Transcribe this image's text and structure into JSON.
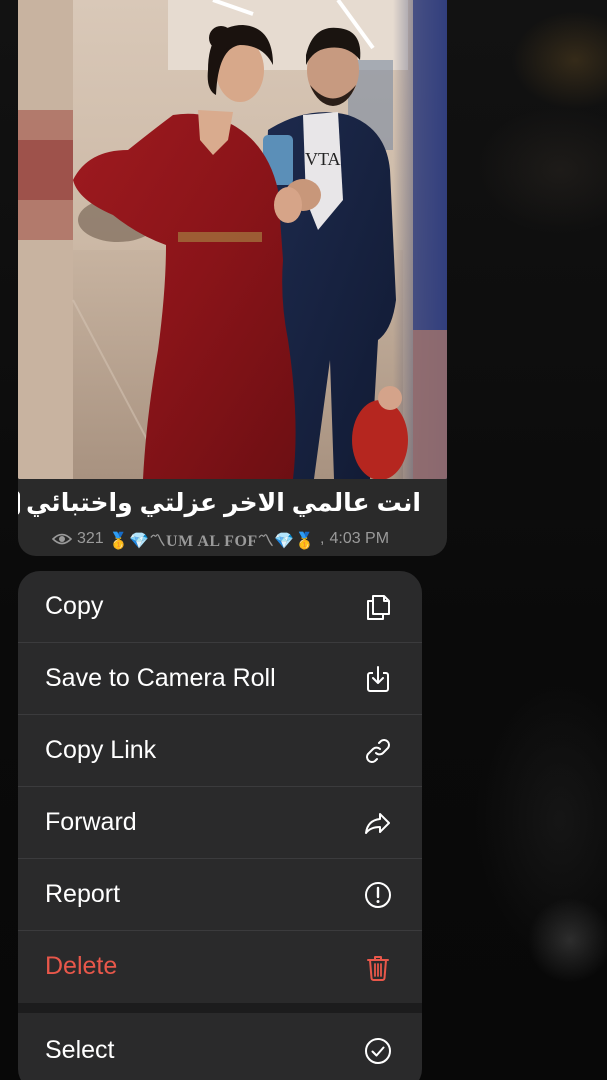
{
  "message": {
    "caption": "انت عالمي الاخر عزلتي واختبائي",
    "caption_icon": "?",
    "views": "321",
    "signature": "🥇💎〽UM AL FOF〽💎🥇",
    "time": "4:03 PM",
    "photo_description_icon": "photo-couple"
  },
  "menu": {
    "items": [
      {
        "label": "Copy",
        "icon": "copy-icon"
      },
      {
        "label": "Save to Camera Roll",
        "icon": "download-icon"
      },
      {
        "label": "Copy Link",
        "icon": "link-icon"
      },
      {
        "label": "Forward",
        "icon": "forward-icon"
      },
      {
        "label": "Report",
        "icon": "report-icon"
      },
      {
        "label": "Delete",
        "icon": "trash-icon"
      },
      {
        "label": "Select",
        "icon": "checkmark-circle-icon"
      }
    ]
  },
  "colors": {
    "menu_background": "#2a2a2b",
    "destructive": "#e8574a",
    "text": "#ffffff"
  }
}
